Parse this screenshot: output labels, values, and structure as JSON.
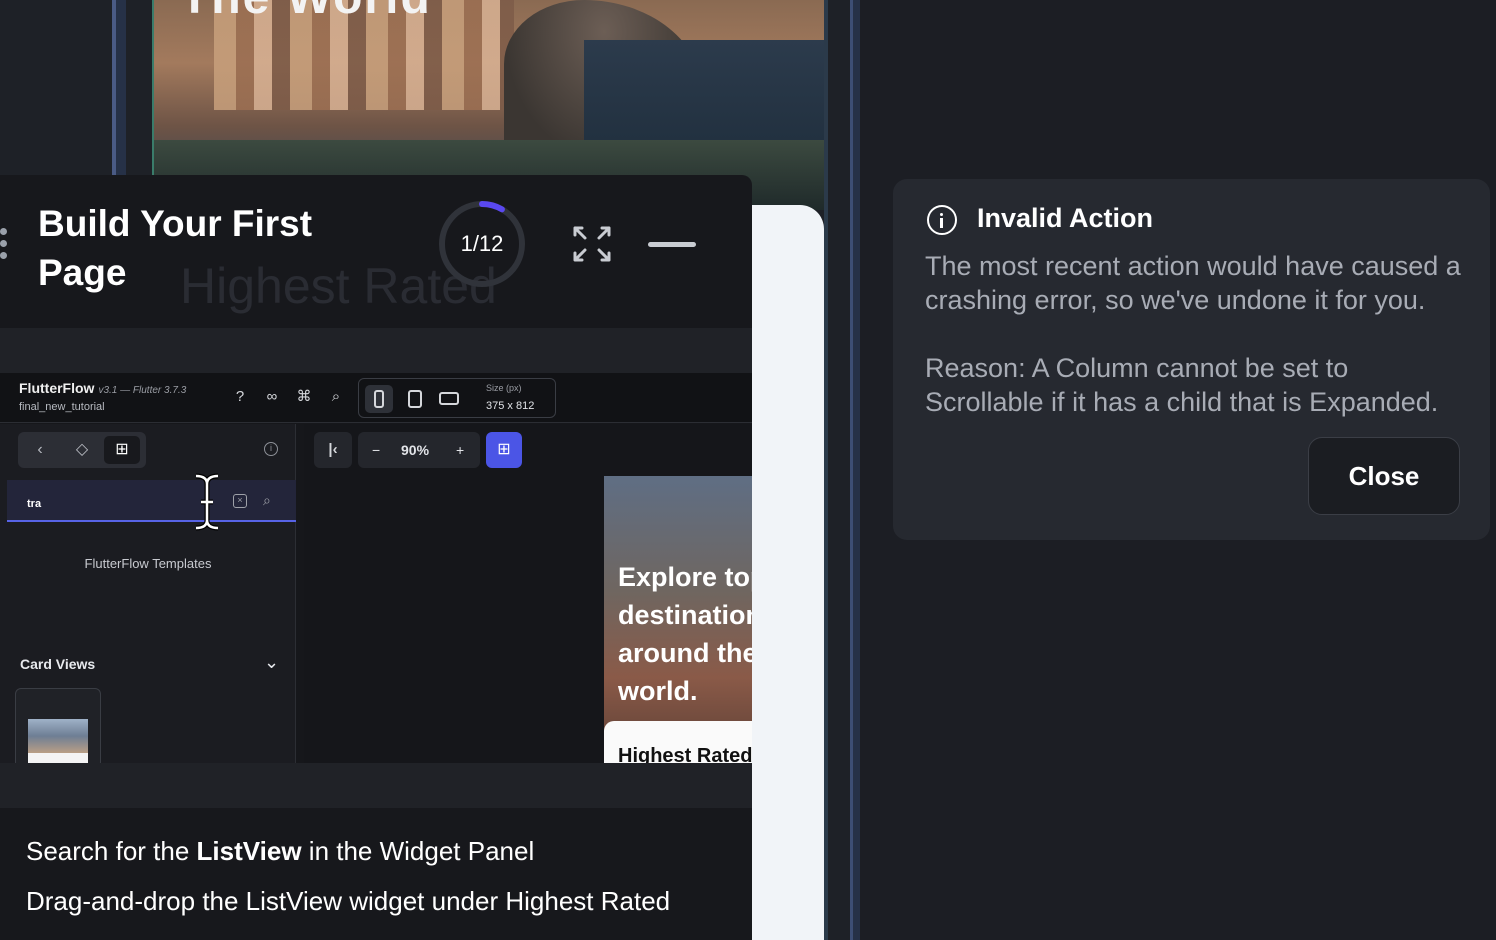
{
  "background": {
    "title_peek": "The World"
  },
  "tutorial": {
    "title": "Build Your First Page",
    "ghost_text": "Highest Rated",
    "progress": {
      "label": "1/12",
      "value": 0.083
    },
    "steps": [
      {
        "prefix": "Search for the ",
        "bold": "ListView",
        "suffix": " in the Widget Panel"
      },
      {
        "prefix": "Drag-and-drop the ListView widget under Highest Rated",
        "bold": "",
        "suffix": ""
      }
    ]
  },
  "embedded_app": {
    "app_name": "FlutterFlow",
    "version": "v3.1 — Flutter 3.7.3",
    "project": "final_new_tutorial",
    "size_label": "Size (px)",
    "size_value": "375 x 812",
    "search_value": "tra",
    "templates_label": "FlutterFlow Templates",
    "card_views_label": "Card Views",
    "zoom": {
      "minus": "−",
      "value": "90%",
      "plus": "+"
    },
    "phone_text": "Explore top destinations around the world.",
    "phone_card_text": "Highest Rated"
  },
  "toast": {
    "title": "Invalid Action",
    "message": "The most recent action would have caused a crashing error, so we've undone it for you.",
    "reason": "Reason: A Column cannot be set to Scrollable if it has a child that is Expanded.",
    "close_label": "Close"
  },
  "colors": {
    "accent": "#5763e6",
    "toast_bg": "#262930",
    "panel_bg": "#17181c"
  }
}
